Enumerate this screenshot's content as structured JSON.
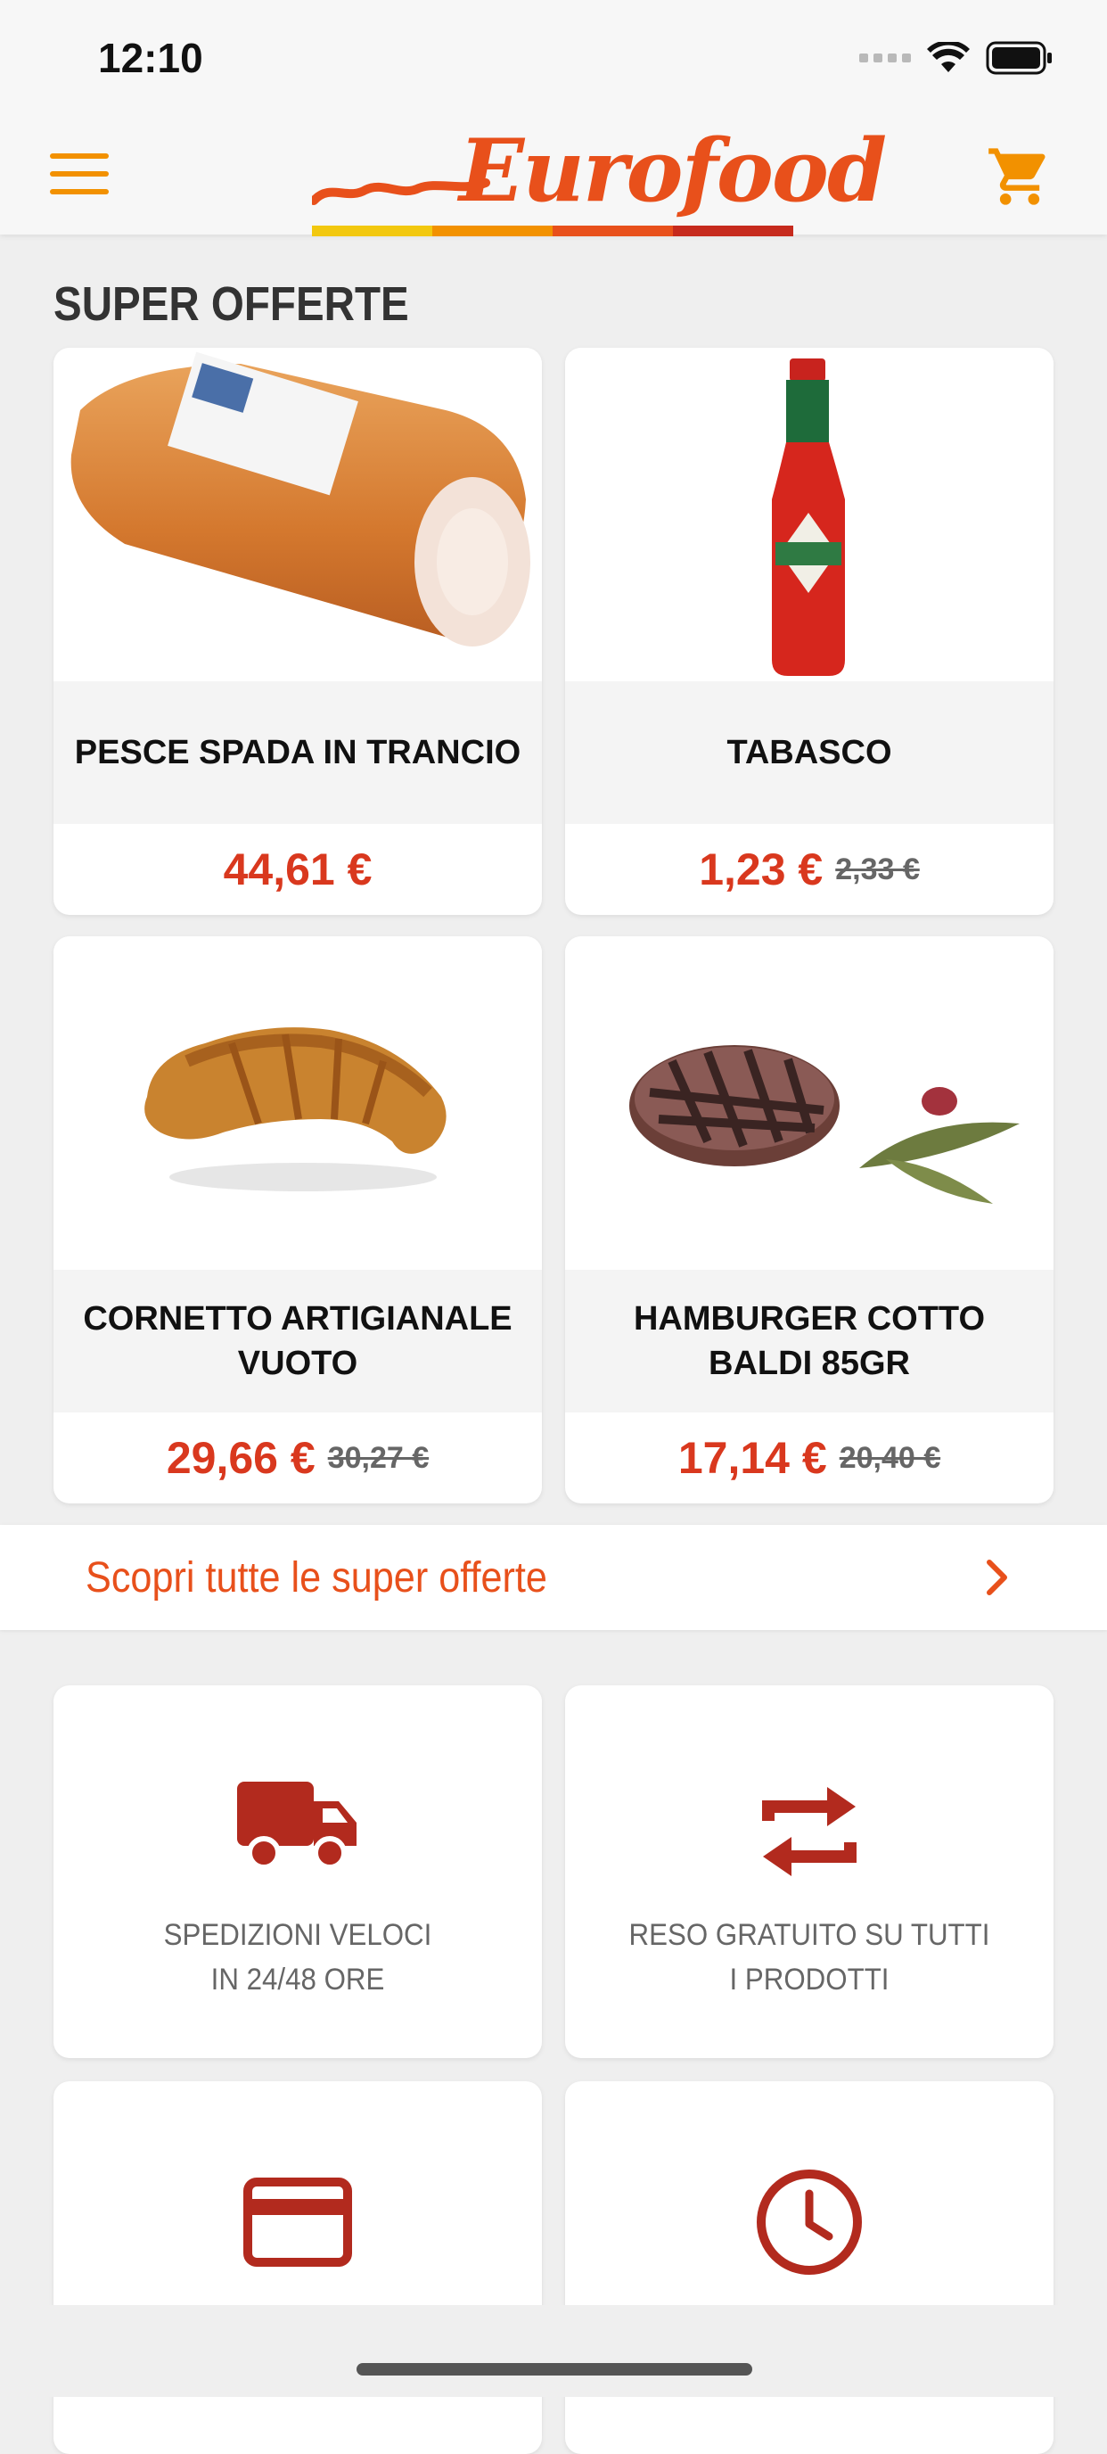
{
  "status_bar": {
    "time": "12:10"
  },
  "header": {
    "brand": "Eurofood",
    "brand_colors": [
      "#f2c80f",
      "#f29100",
      "#e8501b",
      "#c62a1d"
    ]
  },
  "section": {
    "title": "SUPER OFFERTE"
  },
  "products": [
    {
      "name": "PESCE SPADA IN TRANCIO",
      "price": "44,61 €",
      "old_price": ""
    },
    {
      "name": "TABASCO",
      "price": "1,23 €",
      "old_price": "2,33 €"
    },
    {
      "name": "CORNETTO ARTIGIANALE VUOTO",
      "price": "29,66 €",
      "old_price": "30,27 €"
    },
    {
      "name": "HAMBURGER COTTO BALDI 85GR",
      "price": "17,14 €",
      "old_price": "20,40 €"
    }
  ],
  "link": {
    "label": "Scopri tutte le super offerte"
  },
  "features": [
    {
      "line1": "SPEDIZIONI VELOCI",
      "line2": "IN 24/48 ORE",
      "icon": "truck-icon"
    },
    {
      "line1": "RESO GRATUITO SU TUTTI",
      "line2": "I PRODOTTI",
      "icon": "swap-arrows-icon"
    },
    {
      "line1": "",
      "line2": "",
      "icon": "credit-card-icon"
    },
    {
      "line1": "",
      "line2": "",
      "icon": "clock-icon"
    }
  ],
  "colors": {
    "accent": "#e8501b",
    "price": "#d9381e",
    "icon": "#b22a1e",
    "menu": "#f29100"
  }
}
